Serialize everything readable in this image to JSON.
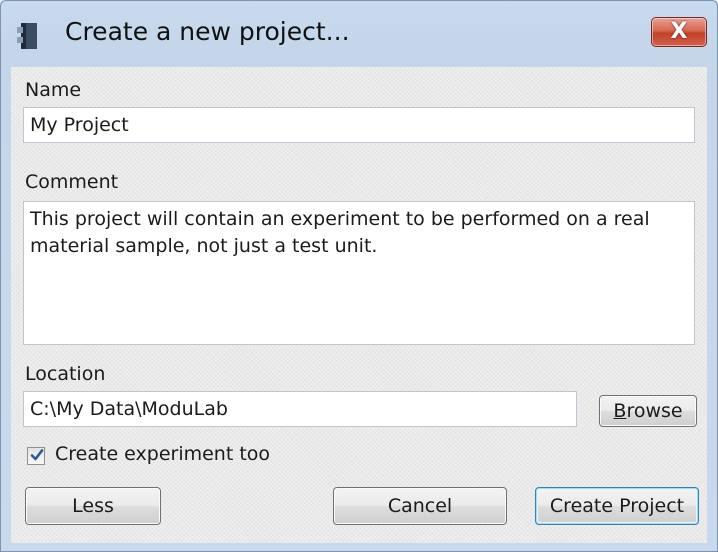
{
  "window": {
    "title": "Create a new project...",
    "close_label": "X"
  },
  "form": {
    "name_label": "Name",
    "name_value": "My Project",
    "comment_label": "Comment",
    "comment_value": "This project will contain an experiment to be performed on a real material sample, not just a test unit.",
    "location_label": "Location",
    "location_value": "C:\\My Data\\ModuLab",
    "browse_accel": "B",
    "browse_rest": "rowse",
    "create_experiment_label": "Create experiment too",
    "create_experiment_checked": true
  },
  "buttons": {
    "less": "Less",
    "cancel": "Cancel",
    "create_project": "Create Project"
  },
  "colors": {
    "check_mark": "#2a5b9a",
    "close_button": "#c8472f"
  }
}
